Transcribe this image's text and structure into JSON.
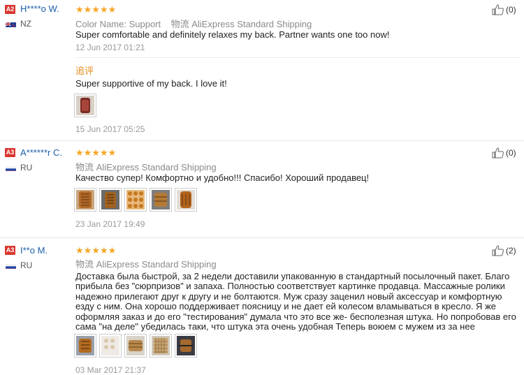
{
  "reviews": [
    {
      "badge": "A2",
      "user": "H****o W.",
      "country": "NZ",
      "flag": "nz",
      "meta_label": "Color Name:",
      "meta_value": "Support",
      "shipping_icon": "物流",
      "shipping": "AliExpress Standard Shipping",
      "text": "Super comfortable and definitely relaxes my back. Partner wants one too now!",
      "date": "12 Jun 2017 01:21",
      "followup_label": "追评",
      "followup_text": "Super supportive of my back. I love it!",
      "followup_date": "15 Jun 2017 05:25",
      "helpful": "(0)",
      "stars": 5
    },
    {
      "badge": "A3",
      "user": "A******r C.",
      "country": "RU",
      "flag": "ru",
      "shipping_icon": "物流",
      "shipping": "AliExpress Standard Shipping",
      "text": "Качество супер! Комфортно и удобно!!! Спасибо! Хороший продавец!",
      "date": "23 Jan 2017 19:49",
      "helpful": "(0)",
      "stars": 5
    },
    {
      "badge": "A3",
      "user": "I**o M.",
      "country": "RU",
      "flag": "ru",
      "shipping_icon": "物流",
      "shipping": "AliExpress Standard Shipping",
      "text": "Доставка была быстрой, за 2 недели доставили упакованную в стандартный посылочный пакет. Благо прибыла без \"сюрпризов\" и запаха. Полностью соответствует картинке продавца. Массажные ролики надежно прилегают друг к другу и не болтаются. Муж сразу заценил новый аксессуар и комфортную езду с ним. Она хорошо поддерживает поясницу и не дает ей колесом вламываться в кресло. Я же оформляя заказ и до его \"тестирования\" думала что это все же- бесполезная штука. Но попробовав его сама \"на деле\" убедилась таки, что штука эта очень удобная Теперь воюем с мужем из за нее",
      "date": "03 Mar 2017 21:37",
      "helpful": "(2)",
      "stars": 5
    }
  ],
  "icons": {
    "star": "★",
    "like": "thumbs-up-icon"
  },
  "colors": {
    "badge": "#d9362f",
    "star": "#f5a623",
    "user": "#1a5ea8",
    "followup": "#e58a1a"
  }
}
